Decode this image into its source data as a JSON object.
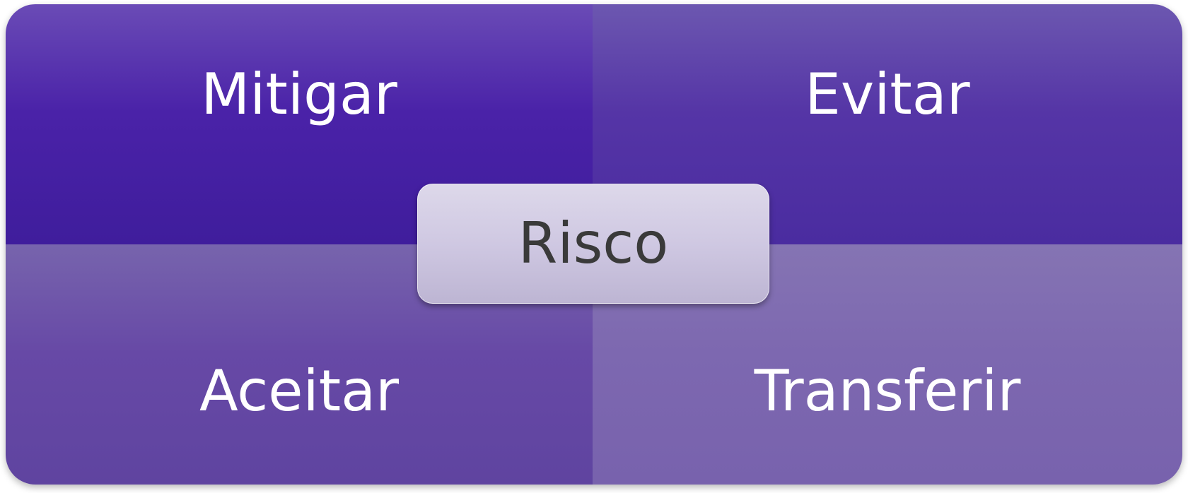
{
  "quadrants": {
    "top_left": {
      "label": "Mitigar",
      "color_top": "#6a4bb6",
      "color_bottom": "#3f1d9c"
    },
    "top_right": {
      "label": "Evitar",
      "color_top": "#6c57b0",
      "color_bottom": "#4a2ca0"
    },
    "bottom_left": {
      "label": "Aceitar",
      "color_top": "#7764ad",
      "color_bottom": "#5f44a0"
    },
    "bottom_right": {
      "label": "Transferir",
      "color_top": "#8574b3",
      "color_bottom": "#7862ad"
    }
  },
  "center": {
    "label": "Risco",
    "bg_top": "#ddd8ea",
    "bg_bottom": "#bdb5d3",
    "text_color": "#3a3a3a"
  },
  "text_color": "#ffffff"
}
